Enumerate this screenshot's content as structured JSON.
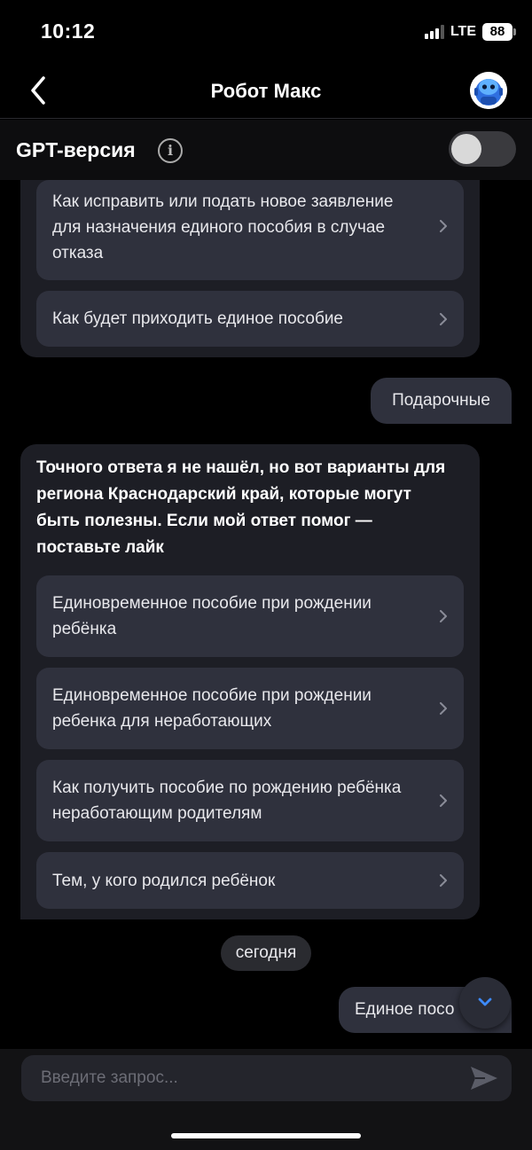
{
  "status_bar": {
    "time": "10:12",
    "network": "LTE",
    "battery": "88"
  },
  "nav": {
    "title": "Робот Макс"
  },
  "gpt_bar": {
    "label": "GPT-версия",
    "info_symbol": "i",
    "toggle_on": false
  },
  "messages": {
    "first_bot": {
      "options": [
        "Как исправить или подать новое заявление для назначения единого пособия в случае отказа",
        "Как будет приходить единое пособие"
      ]
    },
    "user_1": "Подарочные",
    "second_bot": {
      "text": "Точного ответа я не нашёл, но вот варианты для региона Краснодарский край, которые могут быть полезны. Если мой ответ помог — поставьте лайк",
      "options": [
        "Единовременное пособие при рождении ребёнка",
        "Единовременное пособие при рождении ребенка для неработающих",
        "Как получить пособие по рождению ребёнка неработающим родителям",
        "Тем, у кого родился ребёнок"
      ]
    },
    "date_separator": "сегодня",
    "user_2": "Единое посо"
  },
  "input": {
    "placeholder": "Введите запрос..."
  },
  "colors": {
    "background": "#000000",
    "bubble": "#1d1e25",
    "option": "#2f313d",
    "accent": "#2f6fe0"
  }
}
